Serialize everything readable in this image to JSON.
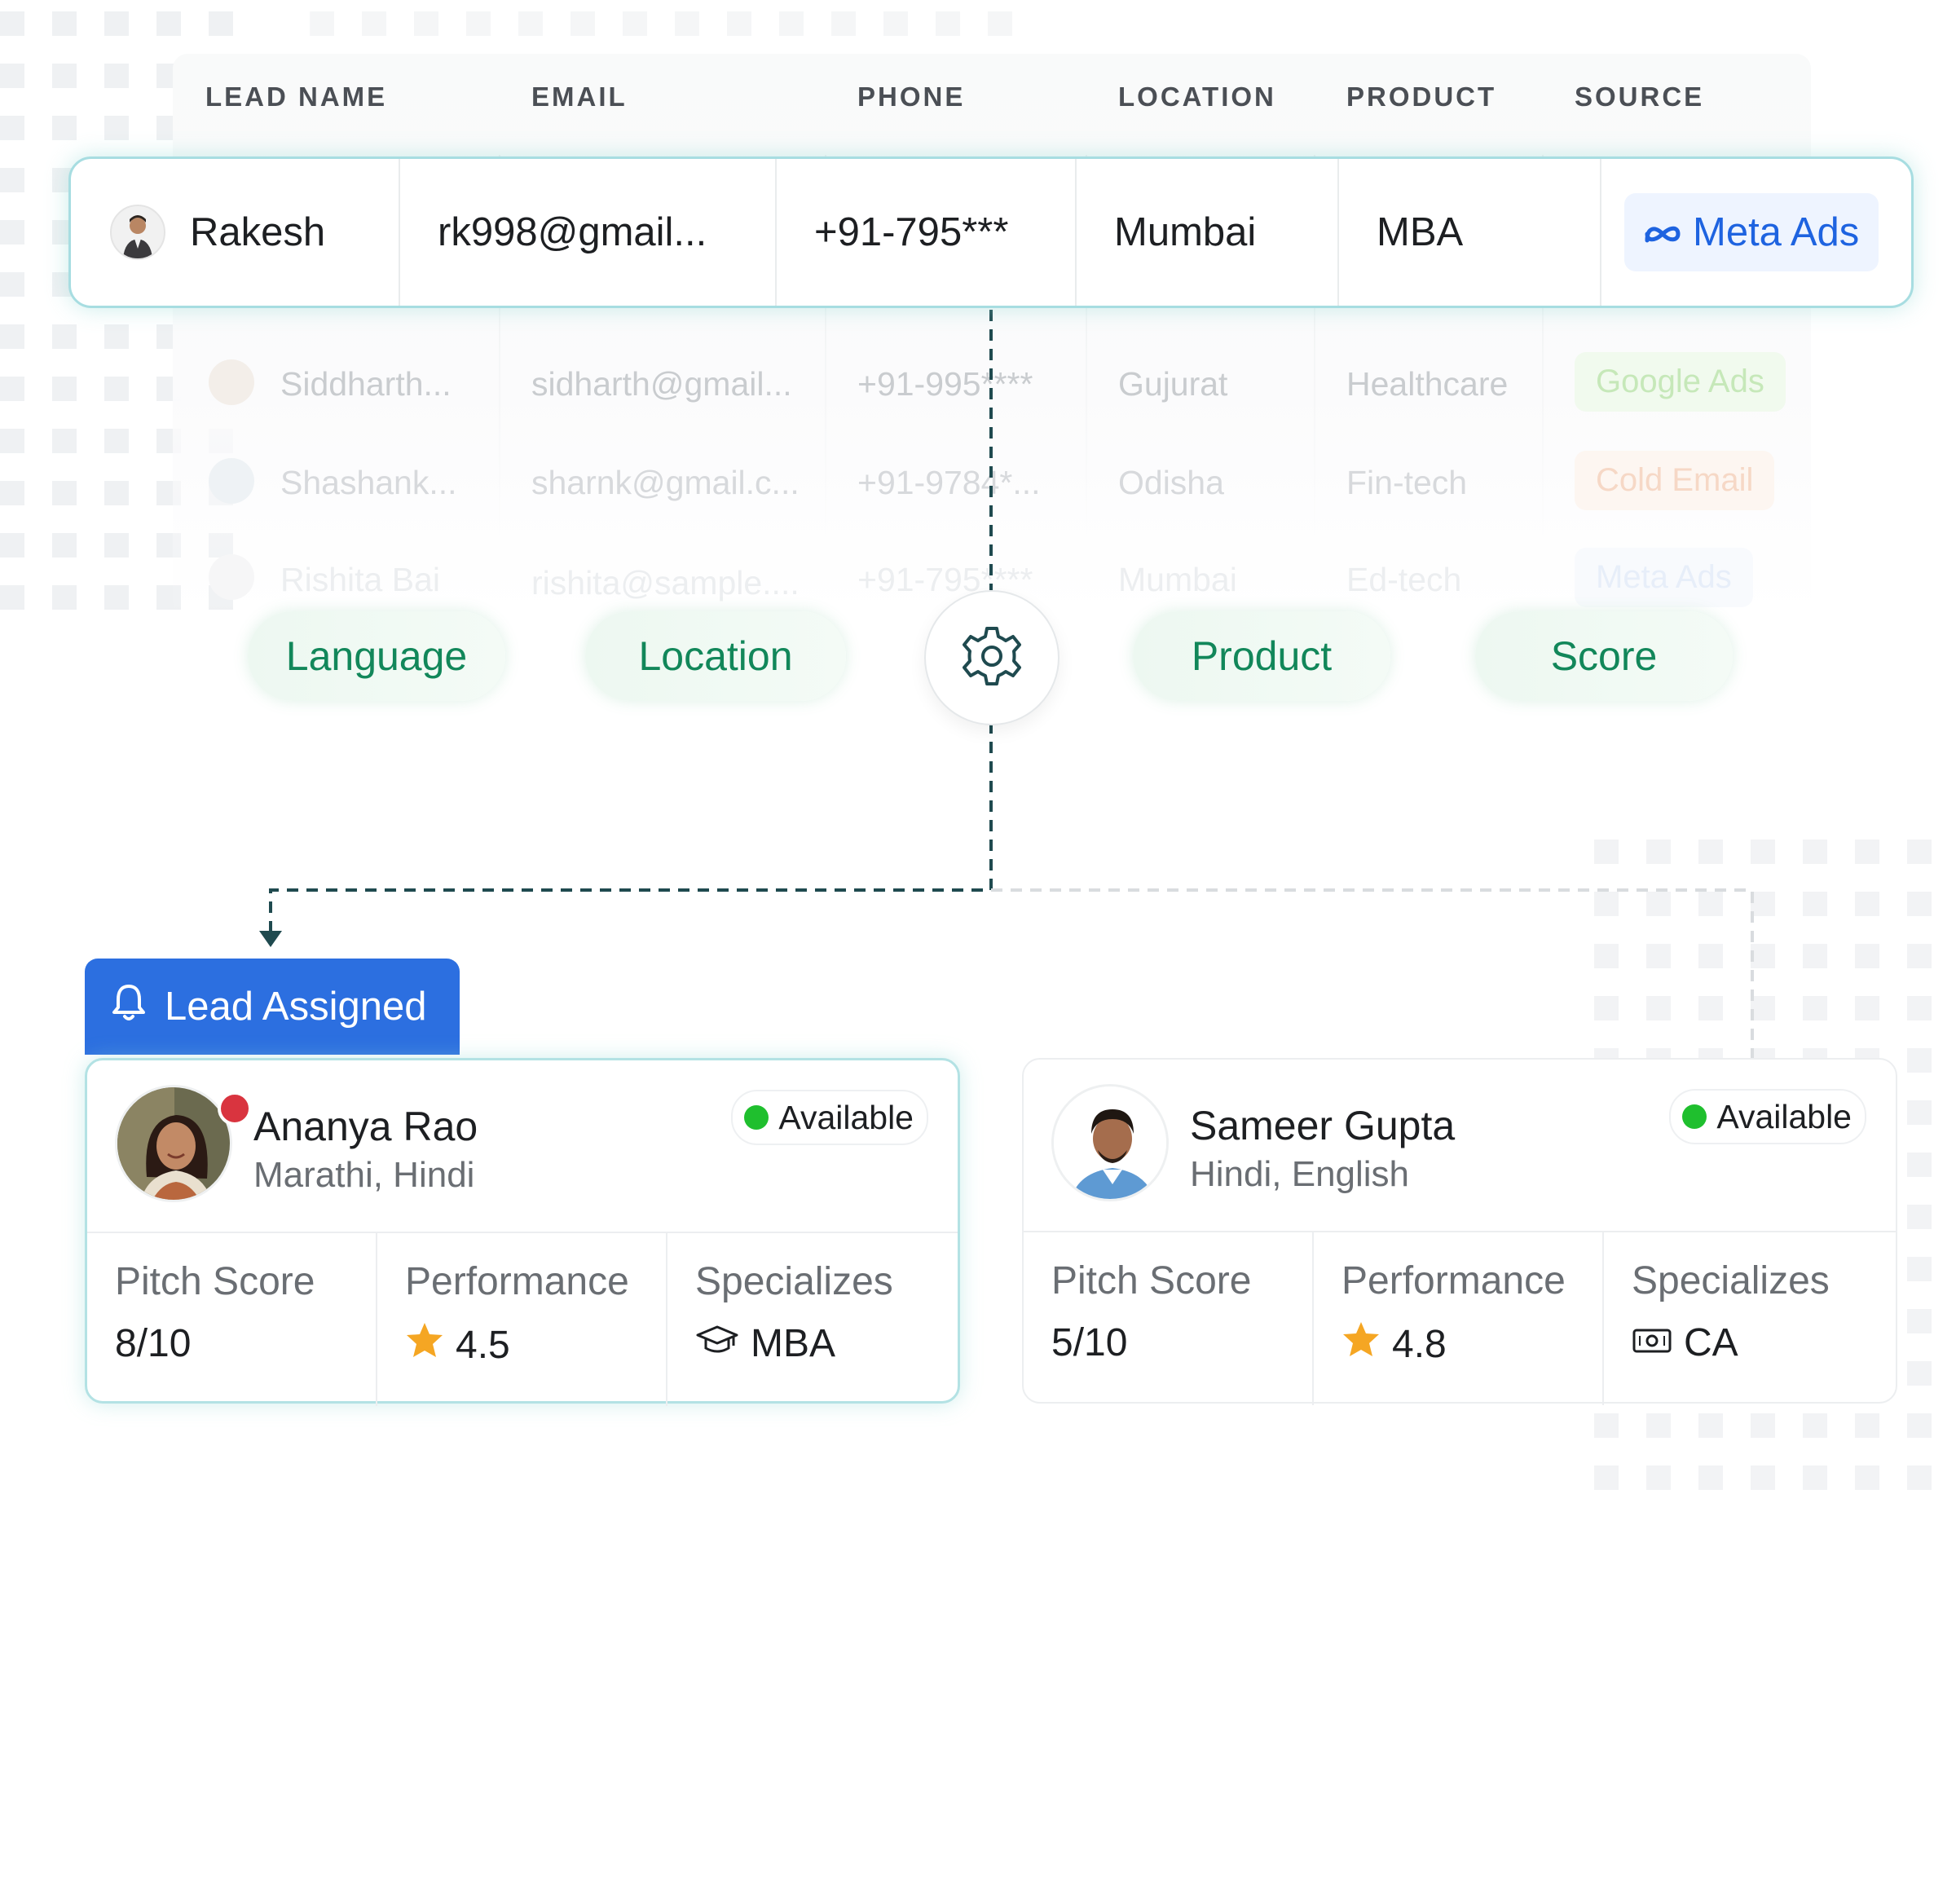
{
  "table": {
    "columns": [
      "LEAD NAME",
      "EMAIL",
      "PHONE",
      "LOCATION",
      "PRODUCT",
      "SOURCE"
    ],
    "highlighted_row": {
      "name": "Rakesh",
      "email": "rk998@gmail...",
      "phone": "+91-795***",
      "location": "Mumbai",
      "product": "MBA",
      "source": "Meta Ads",
      "source_color": "#1e63e0"
    },
    "faded_rows": [
      {
        "name": "Siddharth...",
        "email": "sidharth@gmail...",
        "phone": "+91-995****",
        "location": "Gujurat",
        "product": "Healthcare",
        "source": "Google Ads",
        "source_color": "#c6e8b9"
      },
      {
        "name": "Shashank...",
        "email": "sharnk@gmail.c...",
        "phone": "+91-9784*...",
        "location": "Odisha",
        "product": "Fin-tech",
        "source": "Cold Email",
        "source_color": "#f6d8c6"
      },
      {
        "name": "Rishita Bai",
        "email": "rishita@sample....",
        "phone": "+91-795****",
        "location": "Mumbai",
        "product": "Ed-tech",
        "source": "Meta Ads",
        "source_color": "#e7eef9"
      }
    ]
  },
  "criteria": [
    "Language",
    "Location",
    "Product",
    "Score"
  ],
  "criteria_icon": "gear-icon",
  "lead_assigned": {
    "label": "Lead Assigned",
    "icon": "bell-icon",
    "color": "#2c6fe0"
  },
  "agents": [
    {
      "name": "Ananya Rao",
      "languages": "Marathi, Hindi",
      "status": "Available",
      "pitch_label": "Pitch Score",
      "pitch_value": "8/10",
      "performance_label": "Performance",
      "performance_value": "4.5",
      "specializes_label": "Specializes",
      "specializes_value": "MBA",
      "specializes_icon": "graduation-cap-icon"
    },
    {
      "name": "Sameer Gupta",
      "languages": "Hindi, English",
      "status": "Available",
      "pitch_label": "Pitch Score",
      "pitch_value": "5/10",
      "performance_label": "Performance",
      "performance_value": "4.8",
      "specializes_label": "Specializes",
      "specializes_value": "CA",
      "specializes_icon": "banknote-icon"
    }
  ],
  "colors": {
    "accent_green": "#12875a",
    "available_green": "#1fbf2e",
    "star": "#f5a623",
    "highlight_border": "#a7dde1"
  }
}
